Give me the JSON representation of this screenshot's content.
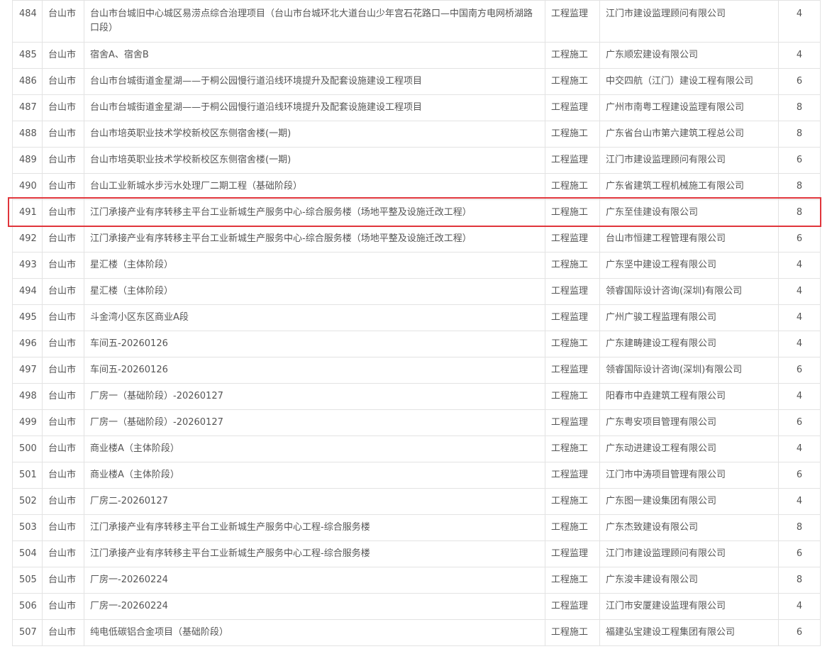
{
  "highlight": {
    "row_number": "491",
    "color": "#e0353b"
  },
  "rows": [
    {
      "no": "484",
      "city": "台山市",
      "project": "台山市台城旧中心城区易涝点综合治理项目（台山市台城环北大道台山少年宫石花路口—中国南方电网桥湖路口段）",
      "type": "工程监理",
      "company": "江门市建设监理顾问有限公司",
      "score": "4"
    },
    {
      "no": "485",
      "city": "台山市",
      "project": "宿舍A、宿舍B",
      "type": "工程施工",
      "company": "广东顺宏建设有限公司",
      "score": "4"
    },
    {
      "no": "486",
      "city": "台山市",
      "project": "台山市台城街道金星湖——于桐公园慢行道沿线环境提升及配套设施建设工程项目",
      "type": "工程施工",
      "company": "中交四航（江门）建设工程有限公司",
      "score": "6"
    },
    {
      "no": "487",
      "city": "台山市",
      "project": "台山市台城街道金星湖——于桐公园慢行道沿线环境提升及配套设施建设工程项目",
      "type": "工程监理",
      "company": "广州市南粤工程建设监理有限公司",
      "score": "8"
    },
    {
      "no": "488",
      "city": "台山市",
      "project": "台山市培英职业技术学校新校区东侧宿舍楼(一期)",
      "type": "工程施工",
      "company": "广东省台山市第六建筑工程总公司",
      "score": "8"
    },
    {
      "no": "489",
      "city": "台山市",
      "project": "台山市培英职业技术学校新校区东侧宿舍楼(一期)",
      "type": "工程监理",
      "company": "江门市建设监理顾问有限公司",
      "score": "6"
    },
    {
      "no": "490",
      "city": "台山市",
      "project": "台山工业新城水步污水处理厂二期工程（基础阶段）",
      "type": "工程施工",
      "company": "广东省建筑工程机械施工有限公司",
      "score": "8"
    },
    {
      "no": "491",
      "city": "台山市",
      "project": "江门承接产业有序转移主平台工业新城生产服务中心-综合服务楼（场地平整及设施迁改工程）",
      "type": "工程施工",
      "company": "广东至佳建设有限公司",
      "score": "8"
    },
    {
      "no": "492",
      "city": "台山市",
      "project": "江门承接产业有序转移主平台工业新城生产服务中心-综合服务楼（场地平整及设施迁改工程）",
      "type": "工程监理",
      "company": "台山市恒建工程管理有限公司",
      "score": "6"
    },
    {
      "no": "493",
      "city": "台山市",
      "project": "星汇楼（主体阶段）",
      "type": "工程施工",
      "company": "广东坚中建设工程有限公司",
      "score": "4"
    },
    {
      "no": "494",
      "city": "台山市",
      "project": "星汇楼（主体阶段）",
      "type": "工程监理",
      "company": "领睿国际设计咨询(深圳)有限公司",
      "score": "4"
    },
    {
      "no": "495",
      "city": "台山市",
      "project": "斗金湾小区东区商业A段",
      "type": "工程监理",
      "company": "广州广骏工程监理有限公司",
      "score": "4"
    },
    {
      "no": "496",
      "city": "台山市",
      "project": "车间五-20260126",
      "type": "工程施工",
      "company": "广东建畴建设工程有限公司",
      "score": "4"
    },
    {
      "no": "497",
      "city": "台山市",
      "project": "车间五-20260126",
      "type": "工程监理",
      "company": "领睿国际设计咨询(深圳)有限公司",
      "score": "6"
    },
    {
      "no": "498",
      "city": "台山市",
      "project": "厂房一（基础阶段）-20260127",
      "type": "工程施工",
      "company": "阳春市中垚建筑工程有限公司",
      "score": "4"
    },
    {
      "no": "499",
      "city": "台山市",
      "project": "厂房一（基础阶段）-20260127",
      "type": "工程监理",
      "company": "广东粤安项目管理有限公司",
      "score": "6"
    },
    {
      "no": "500",
      "city": "台山市",
      "project": "商业楼A（主体阶段）",
      "type": "工程施工",
      "company": "广东动进建设工程有限公司",
      "score": "4"
    },
    {
      "no": "501",
      "city": "台山市",
      "project": "商业楼A（主体阶段）",
      "type": "工程监理",
      "company": "江门市中涛项目管理有限公司",
      "score": "6"
    },
    {
      "no": "502",
      "city": "台山市",
      "project": "厂房二-20260127",
      "type": "工程施工",
      "company": "广东图一建设集团有限公司",
      "score": "4"
    },
    {
      "no": "503",
      "city": "台山市",
      "project": "江门承接产业有序转移主平台工业新城生产服务中心工程-综合服务楼",
      "type": "工程施工",
      "company": "广东杰致建设有限公司",
      "score": "8"
    },
    {
      "no": "504",
      "city": "台山市",
      "project": "江门承接产业有序转移主平台工业新城生产服务中心工程-综合服务楼",
      "type": "工程监理",
      "company": "江门市建设监理顾问有限公司",
      "score": "6"
    },
    {
      "no": "505",
      "city": "台山市",
      "project": "厂房一-20260224",
      "type": "工程施工",
      "company": "广东浚丰建设有限公司",
      "score": "8"
    },
    {
      "no": "506",
      "city": "台山市",
      "project": "厂房一-20260224",
      "type": "工程监理",
      "company": "江门市安厦建设监理有限公司",
      "score": "4"
    },
    {
      "no": "507",
      "city": "台山市",
      "project": "纯电低碳铝合金项目（基础阶段）",
      "type": "工程施工",
      "company": "福建弘宝建设工程集团有限公司",
      "score": "6"
    }
  ]
}
